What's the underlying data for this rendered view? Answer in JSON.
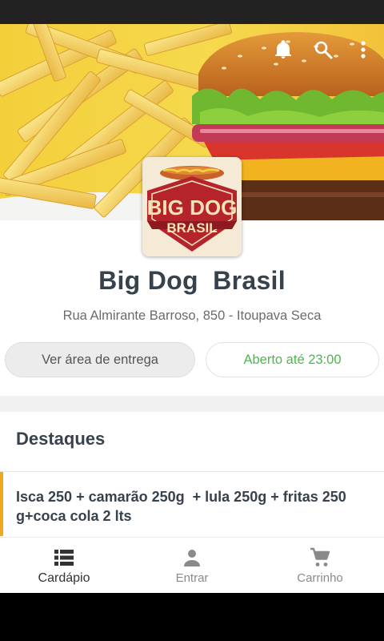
{
  "store": {
    "name": "Big Dog  Brasil",
    "address": "Rua Almirante Barroso, 850 - Itoupava Seca",
    "logo_text_top": "BIG DOG",
    "logo_text_bottom": "BRASIL"
  },
  "header_icons": [
    "bell-icon",
    "search-icon",
    "more-vert-icon"
  ],
  "actions": {
    "delivery_area_label": "Ver área de entrega",
    "open_until_label": "Aberto até 23:00"
  },
  "section": {
    "title": "Destaques"
  },
  "products": [
    {
      "name": "Isca 250 + camarão 250g  + lula 250g + fritas 250 g+coca cola 2 lts"
    }
  ],
  "bottom_nav": {
    "items": [
      {
        "label": "Cardápio",
        "icon": "list-icon",
        "active": true
      },
      {
        "label": "Entrar",
        "icon": "person-icon",
        "active": false
      },
      {
        "label": "Carrinho",
        "icon": "cart-icon",
        "active": false
      }
    ]
  },
  "colors": {
    "accent_green": "#4cb84a",
    "highlight_orange": "#f0a81e",
    "title_dark": "#37424d",
    "logo_red": "#b5242b"
  }
}
